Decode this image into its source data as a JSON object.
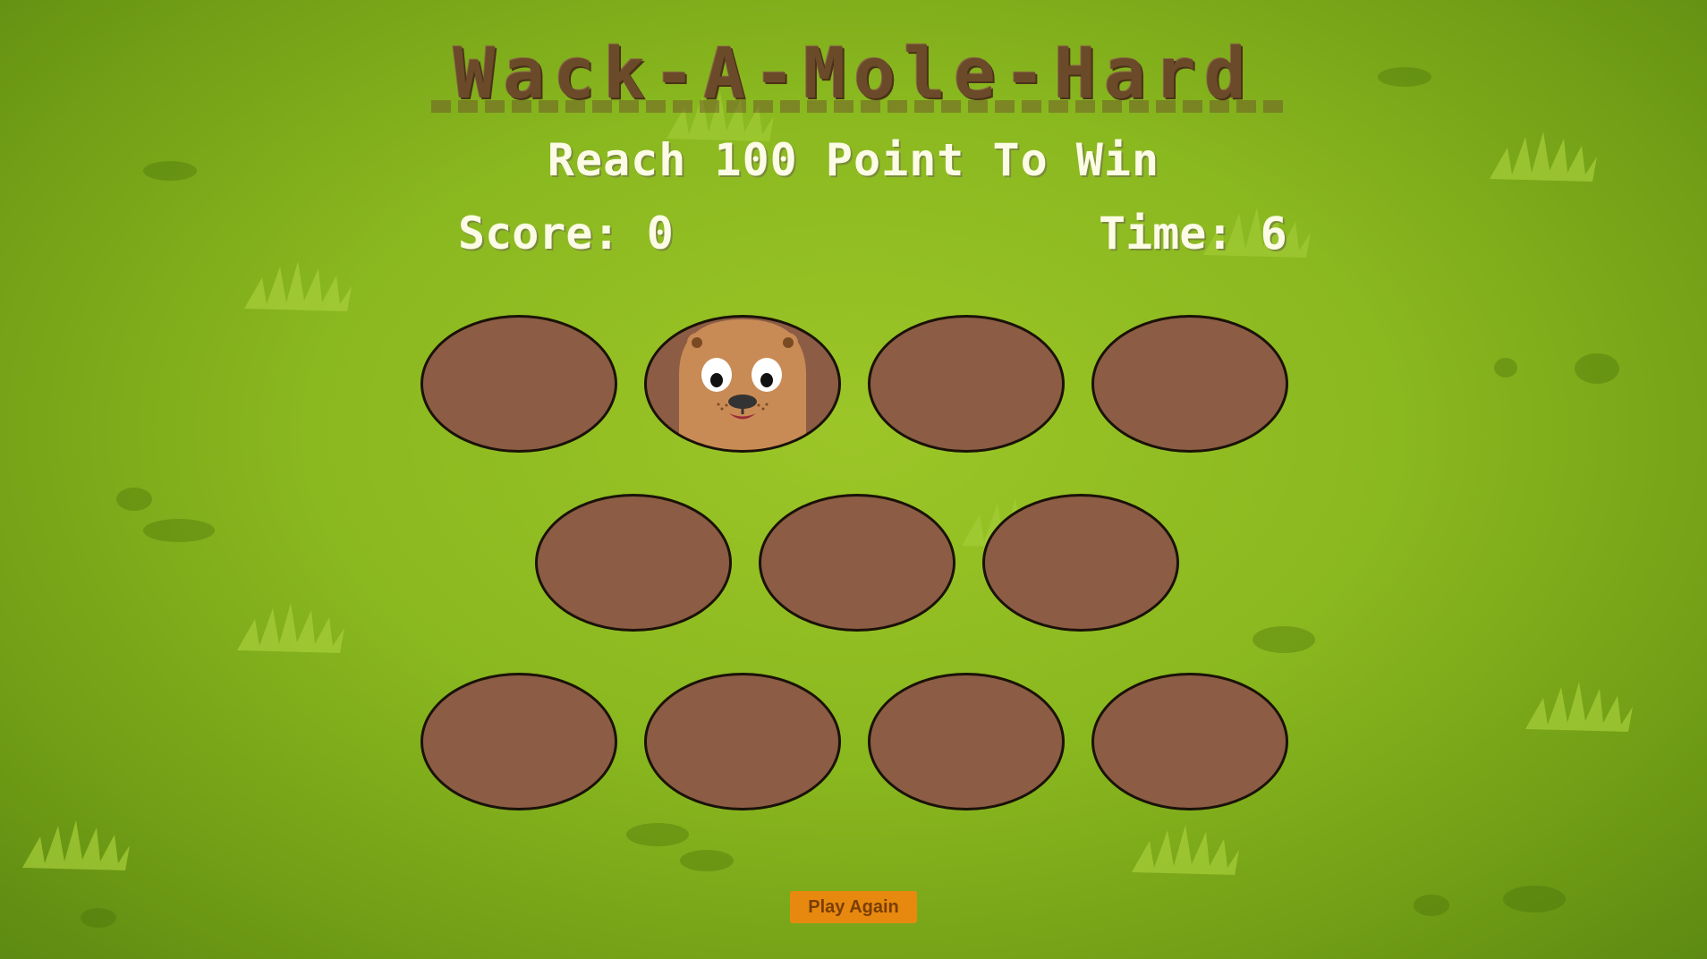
{
  "game": {
    "title": "Wack-A-Mole-Hard",
    "subtitle": "Reach 100 Point To Win",
    "score_label": "Score: 0",
    "time_label": "Time: 6",
    "score": 0,
    "time": 6,
    "target_points": 100,
    "difficulty": "Hard"
  },
  "holes": {
    "count": 11,
    "active_hole": 2,
    "rows": [
      4,
      3,
      4
    ]
  },
  "controls": {
    "play_again_label": "Play Again"
  },
  "colors": {
    "grass": "#8ab81f",
    "hole_fill": "#8c5c45",
    "hole_border": "#1a1208",
    "title_brown": "#6b4a2a",
    "text_cream": "#fbfbe6",
    "button_orange": "#e8890f",
    "button_text": "#7a3e05",
    "mole_fur": "#c98b55"
  },
  "icons": {
    "mole": "mole-icon",
    "grass": "grass-tuft-icon"
  }
}
